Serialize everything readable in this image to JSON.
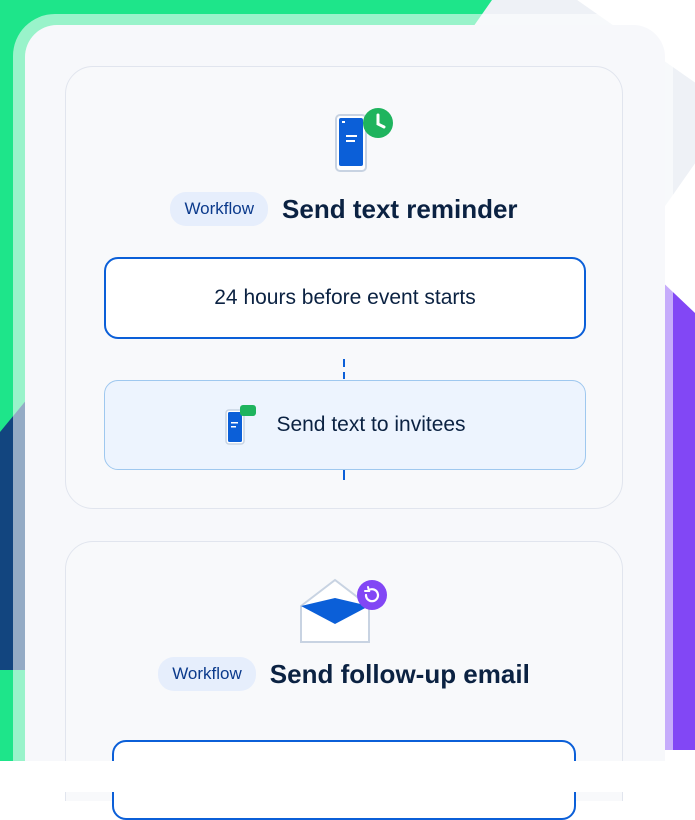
{
  "workflows": [
    {
      "badge": "Workflow",
      "title": "Send text reminder",
      "icon": "phone-clock-icon",
      "trigger": "24 hours before event starts",
      "action": "Send text to invitees",
      "action_icon": "phone-message-icon"
    },
    {
      "badge": "Workflow",
      "title": "Send follow-up email",
      "icon": "envelope-refresh-icon"
    }
  ],
  "colors": {
    "green": "#1ee58a",
    "navy": "#12457f",
    "purple": "#8247f5",
    "blue": "#0b5fd8",
    "dark_text": "#0b2242"
  }
}
